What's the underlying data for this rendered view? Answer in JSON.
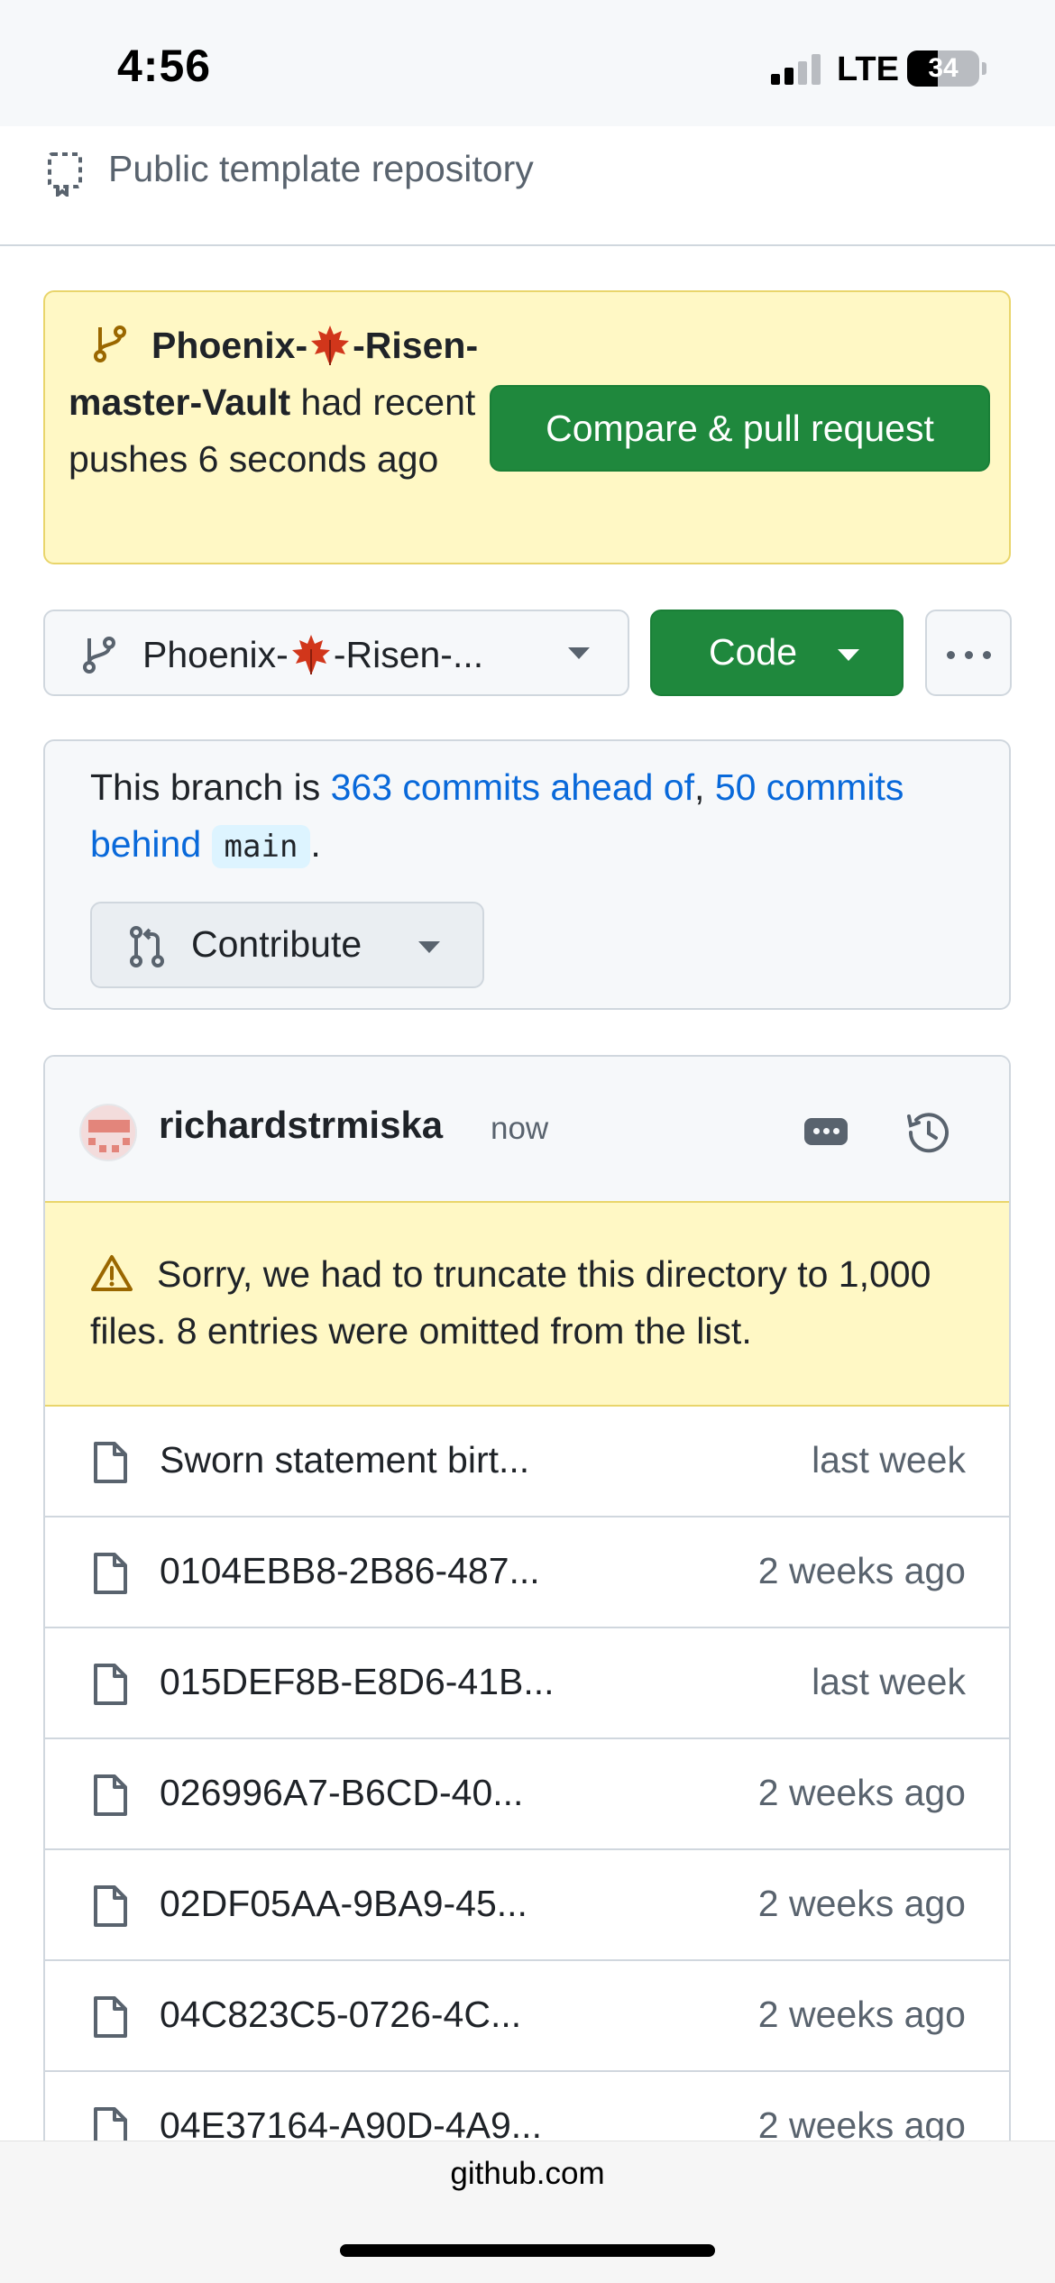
{
  "status_bar": {
    "time": "4:56",
    "network": "LTE",
    "battery": "34"
  },
  "repo": {
    "visibility": "Public template repository"
  },
  "push_banner": {
    "branch_prefix": "Phoenix-",
    "branch_suffix": "-Risen-master-Vault",
    "message": "had recent pushes 6 seconds ago",
    "compare_label": "Compare & pull request"
  },
  "branch_controls": {
    "branch_prefix": "Phoenix-",
    "branch_suffix": "-Risen-...",
    "code_label": "Code"
  },
  "ahead_behind": {
    "prefix": "This branch is ",
    "ahead_link": "363 commits ahead of",
    "separator": ", ",
    "behind_link": "50 commits behind",
    "base_branch": "main",
    "suffix": ".",
    "contribute_label": "Contribute"
  },
  "latest_commit": {
    "author": "richardstrmiska",
    "time": "now"
  },
  "truncate_warning": "Sorry, we had to truncate this directory to 1,000 files. 8 entries were omitted from the list.",
  "files": [
    {
      "name": "Sworn statement birt...",
      "date": "last week"
    },
    {
      "name": "0104EBB8-2B86-487...",
      "date": "2 weeks ago"
    },
    {
      "name": "015DEF8B-E8D6-41B...",
      "date": "last week"
    },
    {
      "name": "026996A7-B6CD-40...",
      "date": "2 weeks ago"
    },
    {
      "name": "02DF05AA-9BA9-45...",
      "date": "2 weeks ago"
    },
    {
      "name": "04C823C5-0726-4C...",
      "date": "2 weeks ago"
    },
    {
      "name": "04E37164-A90D-4A9...",
      "date": "2 weeks ago"
    }
  ],
  "browser": {
    "url": "github.com"
  },
  "colors": {
    "accent_green": "#1f883d",
    "link_blue": "#0969da",
    "warning_bg": "#fff8c5",
    "muted_text": "#59636e"
  },
  "icons": {
    "visibility": "repo-template-icon",
    "branch": "git-branch-icon",
    "emoji": "maple-leaf-icon",
    "contribute": "git-pull-request-icon",
    "warning": "alert-icon",
    "history": "history-icon",
    "file": "file-icon"
  }
}
